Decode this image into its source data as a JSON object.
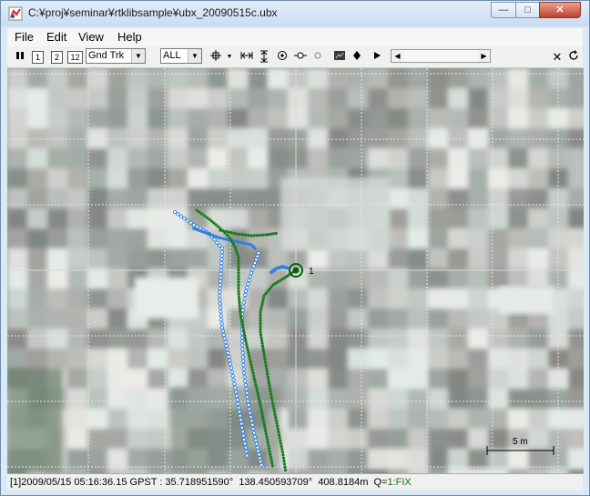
{
  "window": {
    "title": "C:¥proj¥seminar¥rtklibsample¥ubx_20090515c.ubx",
    "minimize_symbol": "—",
    "maximize_symbol": "□",
    "close_symbol": "✕"
  },
  "menu": {
    "file": "File",
    "edit": "Edit",
    "view": "View",
    "help": "Help"
  },
  "toolbar": {
    "btn_1": "1",
    "btn_2": "2",
    "btn_12": "12",
    "plot_type": "Gnd Trk",
    "quality_filter": "ALL"
  },
  "map": {
    "point_label": "1",
    "scale_label": "5 m",
    "colors": {
      "fix": "#1e7a1e",
      "float": "#2f7fe0",
      "cursor": "#0b5d0b"
    }
  },
  "status": {
    "index": "[1]",
    "datetime": "2009/05/15 05:16:36.15 GPST",
    "latitude": "35.718951590°",
    "longitude": "138.450593709°",
    "height": "408.8184m",
    "q_label": "Q=",
    "q_value": "1:FIX"
  }
}
